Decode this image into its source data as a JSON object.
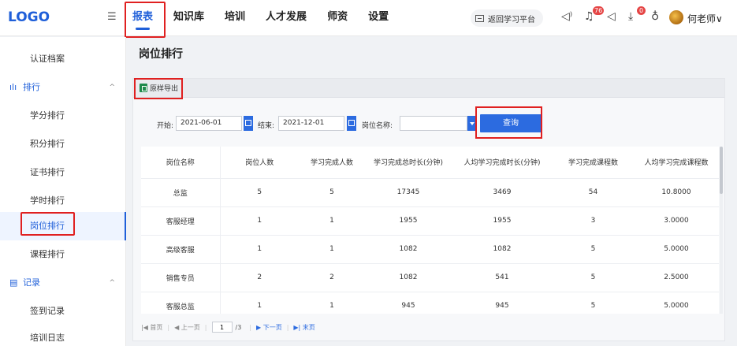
{
  "header": {
    "logo": "LOGO",
    "collapse_icon": "☰",
    "nav": [
      {
        "label": "报表",
        "active": true
      },
      {
        "label": "知识库"
      },
      {
        "label": "培训"
      },
      {
        "label": "人才发展"
      },
      {
        "label": "师资"
      },
      {
        "label": "设置"
      }
    ],
    "return_label": "返回学习平台",
    "msg_badge": "76",
    "download_badge": "0",
    "user_name": "何老师∨"
  },
  "sidebar": {
    "items_top": [
      {
        "label": "认证档案"
      }
    ],
    "group_rank": {
      "label": "排行",
      "icon": "bar-chart-icon"
    },
    "rank_items": [
      {
        "label": "学分排行"
      },
      {
        "label": "积分排行"
      },
      {
        "label": "证书排行"
      },
      {
        "label": "学时排行"
      },
      {
        "label": "岗位排行",
        "active": true
      },
      {
        "label": "课程排行"
      }
    ],
    "group_record": {
      "label": "记录",
      "icon": "record-icon"
    },
    "record_items": [
      {
        "label": "签到记录"
      },
      {
        "label": "培训日志"
      }
    ]
  },
  "main": {
    "page_title": "岗位排行",
    "export_label": "原样导出",
    "filters": {
      "start_label": "开始:",
      "start_value": "2021-06-01",
      "end_label": "结束:",
      "end_value": "2021-12-01",
      "position_label": "岗位名称:",
      "position_value": "",
      "query_label": "查询"
    },
    "table": {
      "columns": [
        "岗位名称",
        "岗位人数",
        "学习完成人数",
        "学习完成总时长(分钟)",
        "人均学习完成时长(分钟)",
        "学习完成课程数",
        "人均学习完成课程数"
      ],
      "rows": [
        [
          "总监",
          "5",
          "5",
          "17345",
          "3469",
          "54",
          "10.8000"
        ],
        [
          "客服经理",
          "1",
          "1",
          "1955",
          "1955",
          "3",
          "3.0000"
        ],
        [
          "高级客服",
          "1",
          "1",
          "1082",
          "1082",
          "5",
          "5.0000"
        ],
        [
          "销售专员",
          "2",
          "2",
          "1082",
          "541",
          "5",
          "2.5000"
        ],
        [
          "客服总监",
          "1",
          "1",
          "945",
          "945",
          "5",
          "5.0000"
        ]
      ]
    },
    "pager": {
      "first": "|◀ 首页",
      "prev": "◀ 上一页",
      "current": "1",
      "total": "/3",
      "next": "▶ 下一页",
      "last": "▶| 末页"
    }
  }
}
